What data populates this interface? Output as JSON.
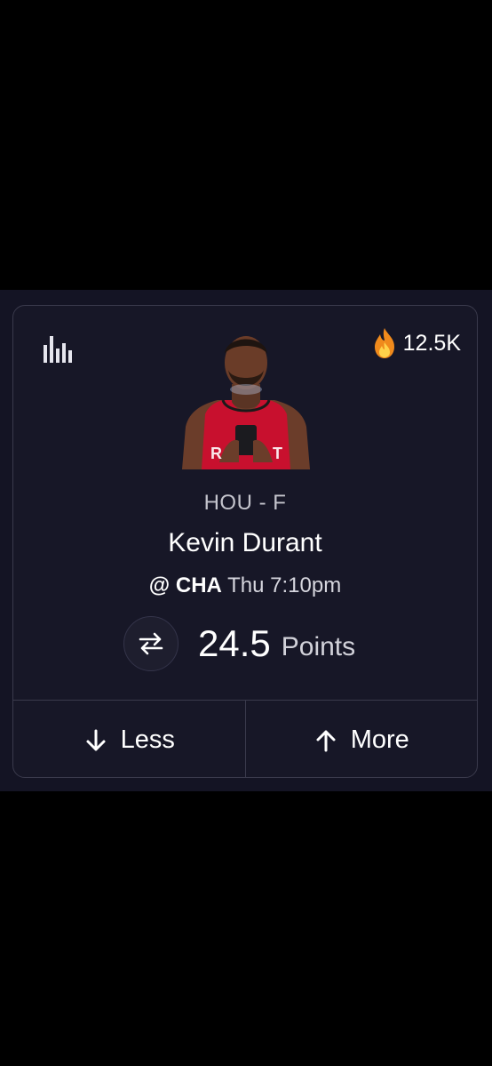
{
  "card": {
    "popularity": "12.5K",
    "team_position": "HOU - F",
    "player_name": "Kevin Durant",
    "matchup": {
      "at": "@",
      "opponent": "CHA",
      "time": "Thu 7:10pm"
    },
    "line": {
      "value": "24.5",
      "stat": "Points"
    },
    "picks": {
      "less_label": "Less",
      "more_label": "More"
    }
  },
  "icons": {
    "stats": "bar-chart-icon",
    "popularity": "flame-icon",
    "swap": "swap-arrows-icon",
    "less": "arrow-down-icon",
    "more": "arrow-up-icon"
  },
  "colors": {
    "background": "#000000",
    "panel": "#141424",
    "card": "#171727",
    "border": "#3a3a4c",
    "flame": "#f5a623",
    "jersey": "#c8102e"
  }
}
